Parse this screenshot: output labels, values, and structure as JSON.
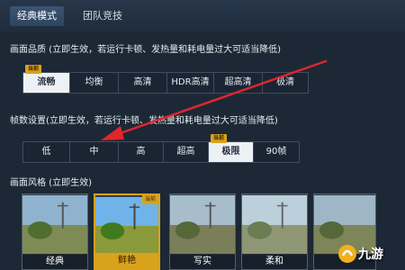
{
  "tabs": [
    {
      "label": "经典模式",
      "active": true
    },
    {
      "label": "团队竞技",
      "active": false
    }
  ],
  "quality": {
    "title": "画面品质 (立即生效，若运行卡顿、发热量和耗电量过大可适当降低)",
    "current_tag": "当前",
    "options": [
      "流畅",
      "均衡",
      "高清",
      "HDR高清",
      "超高清",
      "极清"
    ],
    "selected": "流畅"
  },
  "framerate": {
    "title": "帧数设置(立即生效，若运行卡顿、发热量和耗电量过大可适当降低)",
    "current_tag": "当前",
    "options": [
      "低",
      "中",
      "高",
      "超高",
      "极限",
      "90帧"
    ],
    "selected": "极限"
  },
  "style": {
    "title": "画面风格 (立即生效)",
    "current_tag": "当前",
    "cards": [
      "经典",
      "鲜艳",
      "写实",
      "柔和",
      ""
    ],
    "selected": "鲜艳"
  },
  "watermark": {
    "text": "九游"
  },
  "colors": {
    "background": "#1d2836",
    "accent": "#d9a21b",
    "arrow": "#e0262b"
  }
}
